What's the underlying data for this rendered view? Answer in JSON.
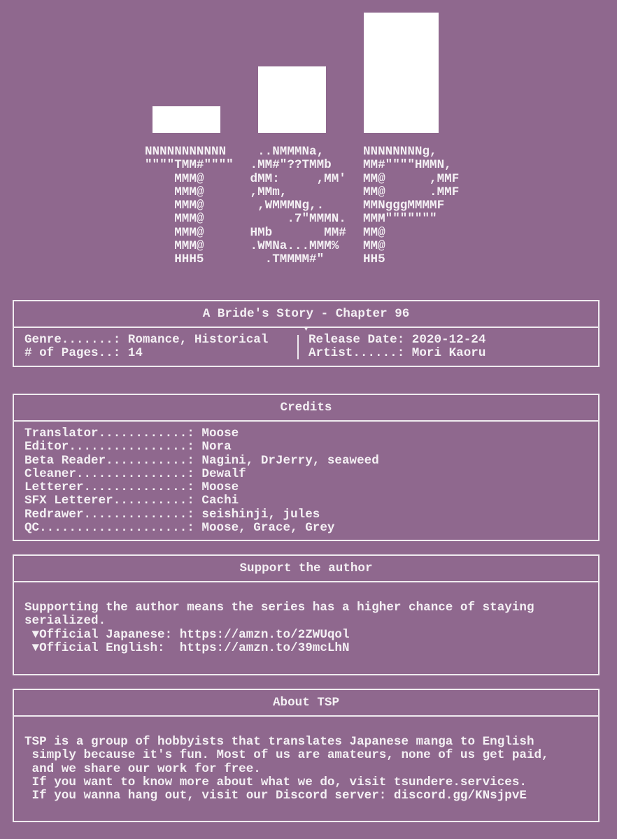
{
  "logo": {
    "ascii_columns": [
      "NNNNNNNNNNN\n\"\"\"\"TMM#\"\"\"\"\n    MMM@\n    MMM@\n    MMM@\n    MMM@\n    MMM@\n    MMM@\n    HHH5",
      "  ..NMMMNa,\n .MM#\"??TMMb\n dMM:     ,MM'\n ,MMm,\n  ,WMMMNg,.\n      .7\"MMMN.\n HMb       MM#\n .WMNa...MMM%\n   .TMMMM#\"",
      "NNNNNNNNg,\nMM#\"\"\"\"HMMN,\nMM@      ,MMF\nMM@      .MMF\nMMNgggMMMMF\nMMM\"\"\"\"\"\"\"\nMM@\nMM@\nHH5"
    ]
  },
  "info": {
    "title": "A Bride's Story - Chapter 96",
    "genre": "Genre.......: Romance, Historical",
    "pages": "# of Pages..: 14",
    "release": "Release Date: 2020-12-24",
    "artist": "Artist......: Mori Kaoru"
  },
  "credits": {
    "title": "Credits",
    "lines": [
      "Translator............: Moose",
      "Editor................: Nora",
      "Beta Reader...........: Nagini, DrJerry, seaweed",
      "Cleaner...............: Dewalf",
      "Letterer..............: Moose",
      "SFX Letterer..........: Cachi",
      "Redrawer..............: seishinji, jules",
      "QC....................: Moose, Grace, Grey"
    ]
  },
  "support": {
    "title": "Support the author",
    "lines": [
      "Supporting the author means the series has a higher chance of staying",
      "serialized.",
      " ▼Official Japanese: https://amzn.to/2ZWUqol",
      " ▼Official English:  https://amzn.to/39mcLhN"
    ]
  },
  "about": {
    "title": "About TSP",
    "lines": [
      "TSP is a group of hobbyists that translates Japanese manga to English",
      " simply because it's fun. Most of us are amateurs, none of us get paid,",
      " and we share our work for free.",
      " If you want to know more about what we do, visit tsundere.services.",
      " If you wanna hang out, visit our Discord server: discord.gg/KNsjpvE"
    ]
  }
}
